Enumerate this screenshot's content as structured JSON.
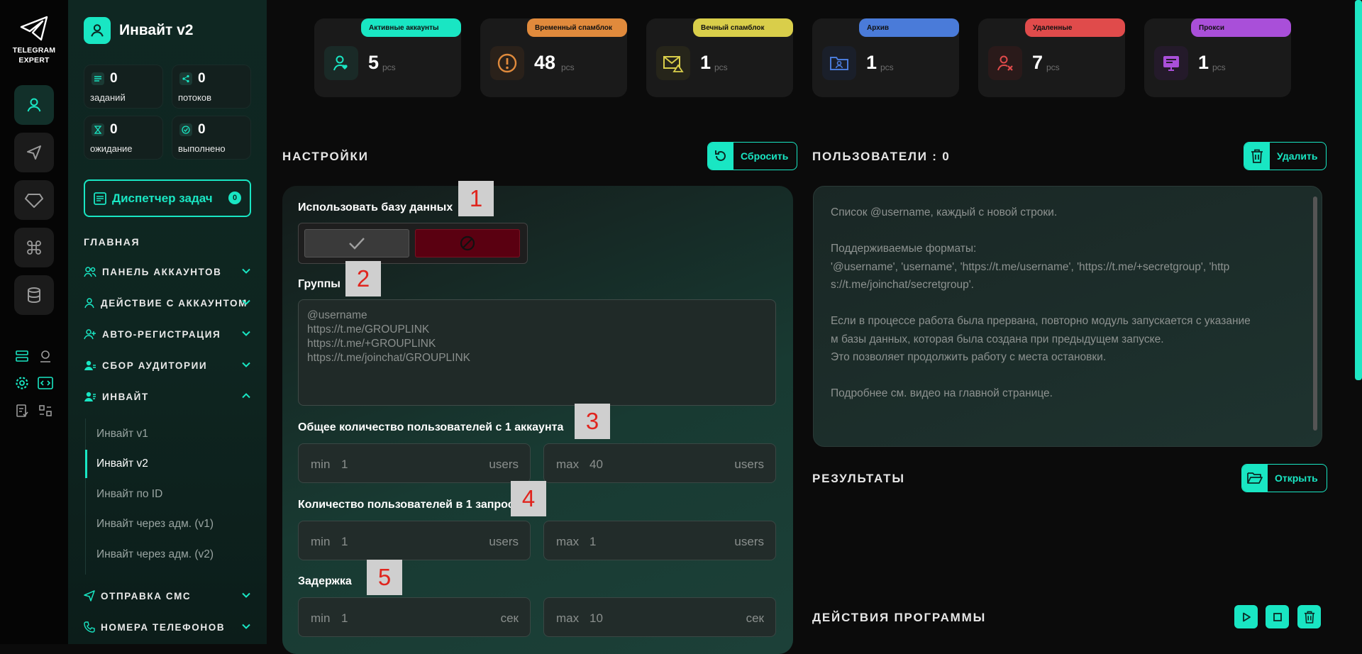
{
  "app": {
    "logo_line1": "TELEGRAM",
    "logo_line2": "EXPERT",
    "accent": "#19E6C3"
  },
  "sidebar": {
    "title": "Инвайт v2",
    "stats": [
      {
        "value": "0",
        "label": "заданий",
        "icon": "tasks-icon"
      },
      {
        "value": "0",
        "label": "потоков",
        "icon": "threads-icon"
      },
      {
        "value": "0",
        "label": "ожидание",
        "icon": "hourglass-icon"
      },
      {
        "value": "0",
        "label": "выполнено",
        "icon": "check-circle-icon"
      }
    ],
    "dispatcher": {
      "label": "Диспетчер задач",
      "count": "0"
    },
    "section": "ГЛАВНАЯ",
    "nav": [
      {
        "label": "ПАНЕЛЬ АККАУНТОВ",
        "icon": "users-icon"
      },
      {
        "label": "ДЕЙСТВИЕ С АККАУНТОМ",
        "icon": "user-icon"
      },
      {
        "label": "АВТО-РЕГИСТРАЦИЯ",
        "icon": "user-plus-icon"
      },
      {
        "label": "СБОР АУДИТОРИИ",
        "icon": "audience-icon"
      },
      {
        "label": "ИНВАЙТ",
        "icon": "invite-icon"
      },
      {
        "label": "ОТПРАВКА СМС",
        "icon": "send-icon"
      },
      {
        "label": "НОМЕРА ТЕЛЕФОНОВ",
        "icon": "phone-icon"
      }
    ],
    "sub": [
      "Инвайт v1",
      "Инвайт v2",
      "Инвайт по ID",
      "Инвайт через адм. (v1)",
      "Инвайт через адм. (v2)"
    ]
  },
  "cards": [
    {
      "label": "Активные аккаунты",
      "value": "5",
      "unit": "pcs",
      "color": "#19E6C3"
    },
    {
      "label": "Временный спамблок",
      "value": "48",
      "unit": "pcs",
      "color": "#E08A3C"
    },
    {
      "label": "Вечный спамблок",
      "value": "1",
      "unit": "pcs",
      "color": "#D9CE4A"
    },
    {
      "label": "Архив",
      "value": "1",
      "unit": "pcs",
      "color": "#4A7BD9"
    },
    {
      "label": "Удаленные",
      "value": "7",
      "unit": "pcs",
      "color": "#E04B4B"
    },
    {
      "label": "Прокси",
      "value": "1",
      "unit": "pcs",
      "color": "#A94FD9"
    }
  ],
  "settings": {
    "title": "НАСТРОЙКИ",
    "reset": "Сбросить",
    "use_db": "Использовать базу данных",
    "groups": "Группы",
    "groups_placeholder": "@username\nhttps://t.me/GROUPLINK\nhttps://t.me/+GROUPLINK\nhttps://t.me/joinchat/GROUPLINK",
    "total_users": "Общее количество пользователей с 1 аккаунта",
    "per_request": "Количество пользователей в 1 запросе",
    "delay": "Задержка",
    "total": {
      "min_label": "min",
      "min": "1",
      "max_label": "max",
      "max": "40",
      "unit": "users"
    },
    "request": {
      "min_label": "min",
      "min": "1",
      "max_label": "max",
      "max": "1",
      "unit": "users"
    },
    "delay_vals": {
      "min_label": "min",
      "min": "1",
      "max_label": "max",
      "max": "10",
      "unit": "сек"
    },
    "tags": [
      "1",
      "2",
      "3",
      "4",
      "5"
    ]
  },
  "users": {
    "title": "ПОЛЬЗОВАТЕЛИ : 0",
    "delete": "Удалить",
    "placeholder": "Список @username, каждый с новой строки.\n\nПоддерживаемые форматы:\n'@username', 'username', 'https://t.me/username', 'https://t.me/+secretgroup', 'http\ns://t.me/joinchat/secretgroup'.\n\nЕсли в процессе работа была прервана, повторно модуль запускается с указание\nм базы данных, которая была создана при предыдущем запуске.\nЭто позволяет продолжить работу с места остановки.\n\nПодробнее см. видео на главной странице."
  },
  "results": {
    "title": "РЕЗУЛЬТАТЫ",
    "open": "Открыть"
  },
  "actions": {
    "title": "ДЕЙСТВИЯ ПРОГРАММЫ"
  }
}
